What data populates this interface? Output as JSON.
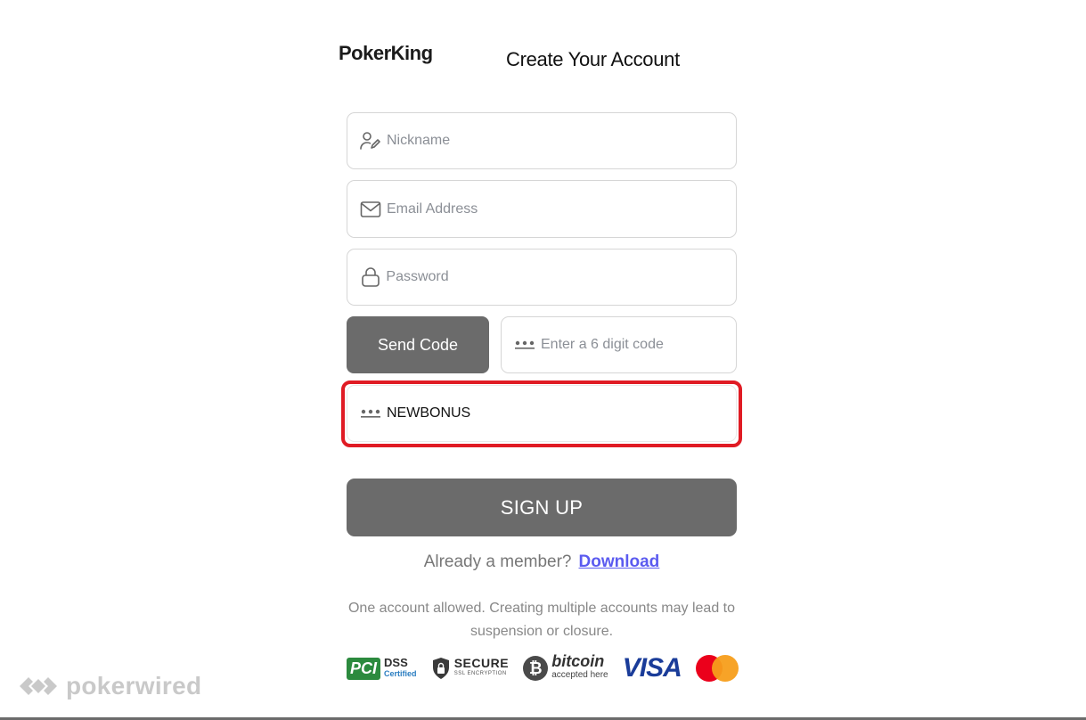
{
  "header": {
    "logo_text": "PokerKing",
    "title": "Create Your Account"
  },
  "form": {
    "nickname_placeholder": "Nickname",
    "email_placeholder": "Email Address",
    "password_placeholder": "Password",
    "send_code_label": "Send Code",
    "code_placeholder": "Enter a 6 digit code",
    "promo_value": "NEWBONUS",
    "signup_label": "SIGN UP"
  },
  "footer": {
    "already_member": "Already a member?",
    "download_link": "Download",
    "notice": "One account allowed. Creating multiple accounts may lead to suspension or closure."
  },
  "badges": {
    "pci": "PCI",
    "pci_dss": "DSS",
    "pci_certified": "Certified",
    "secure": "SECURE",
    "secure_sub": "SSL ENCRYPTION",
    "bitcoin_symbol": "₿",
    "bitcoin": "bitcoin",
    "bitcoin_sub": "accepted here",
    "visa": "VISA"
  },
  "watermark": {
    "text": "pokerwired"
  },
  "colors": {
    "button_gray": "#6b6b6b",
    "highlight_red": "#e01b24",
    "link_blue": "#5b5bf0",
    "visa_blue": "#1a3c99"
  }
}
